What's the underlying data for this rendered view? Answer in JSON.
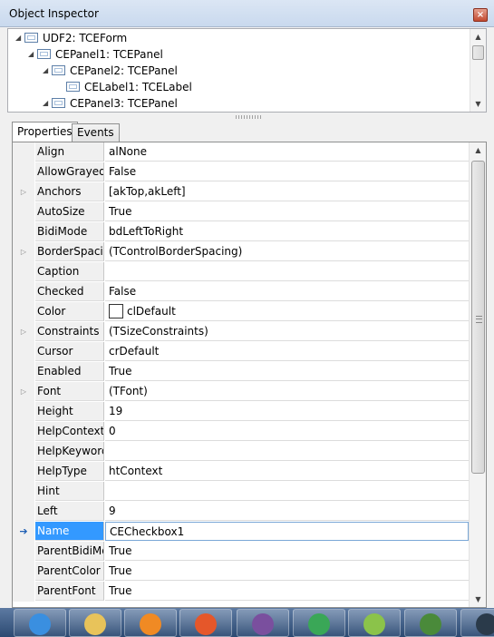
{
  "window": {
    "title": "Object Inspector",
    "close_glyph": "×"
  },
  "tree": {
    "nodes": [
      {
        "label": "UDF2: TCEForm",
        "expander": "◢"
      },
      {
        "label": "CEPanel1: TCEPanel",
        "expander": "◢"
      },
      {
        "label": "CEPanel2: TCEPanel",
        "expander": "◢"
      },
      {
        "label": "CELabel1: TCELabel",
        "expander": ""
      },
      {
        "label": "CEPanel3: TCEPanel",
        "expander": "◢"
      }
    ]
  },
  "tabs": [
    {
      "label": "Properties",
      "active": true
    },
    {
      "label": "Events",
      "active": false
    }
  ],
  "properties": [
    {
      "name": "Align",
      "value": "alNone",
      "expandable": false
    },
    {
      "name": "AllowGrayed",
      "value": "False",
      "expandable": false
    },
    {
      "name": "Anchors",
      "value": "[akTop,akLeft]",
      "expandable": true
    },
    {
      "name": "AutoSize",
      "value": "True",
      "expandable": false
    },
    {
      "name": "BidiMode",
      "value": "bdLeftToRight",
      "expandable": false
    },
    {
      "name": "BorderSpacing",
      "value": "(TControlBorderSpacing)",
      "expandable": true
    },
    {
      "name": "Caption",
      "value": "",
      "expandable": false
    },
    {
      "name": "Checked",
      "value": "False",
      "expandable": false
    },
    {
      "name": "Color",
      "value": "clDefault",
      "expandable": false,
      "swatch": "#ffffff"
    },
    {
      "name": "Constraints",
      "value": "(TSizeConstraints)",
      "expandable": true
    },
    {
      "name": "Cursor",
      "value": "crDefault",
      "expandable": false
    },
    {
      "name": "Enabled",
      "value": "True",
      "expandable": false
    },
    {
      "name": "Font",
      "value": "(TFont)",
      "expandable": true
    },
    {
      "name": "Height",
      "value": "19",
      "expandable": false
    },
    {
      "name": "HelpContext",
      "value": "0",
      "expandable": false
    },
    {
      "name": "HelpKeyword",
      "value": "",
      "expandable": false
    },
    {
      "name": "HelpType",
      "value": "htContext",
      "expandable": false
    },
    {
      "name": "Hint",
      "value": "",
      "expandable": false
    },
    {
      "name": "Left",
      "value": "9",
      "expandable": false
    },
    {
      "name": "Name",
      "value": "CECheckbox1",
      "expandable": false,
      "selected": true
    },
    {
      "name": "ParentBidiMode",
      "value": "True",
      "expandable": false
    },
    {
      "name": "ParentColor",
      "value": "True",
      "expandable": false
    },
    {
      "name": "ParentFont",
      "value": "True",
      "expandable": false
    }
  ],
  "glyphs": {
    "expand": "▷",
    "current": "➔",
    "up": "▲",
    "down": "▼"
  },
  "colors": {
    "selection": "#3399ff",
    "gutter": "#f0f0f0",
    "taskbar": "#2c4a72"
  },
  "taskbar": {
    "apps": [
      {
        "name": "internet-explorer-icon",
        "color": "#3a8fe0"
      },
      {
        "name": "file-explorer-icon",
        "color": "#e8c35a"
      },
      {
        "name": "media-player-icon",
        "color": "#f08a24"
      },
      {
        "name": "firefox-icon",
        "color": "#e5572a"
      },
      {
        "name": "tor-browser-icon",
        "color": "#7a4f9e"
      },
      {
        "name": "chrome-icon",
        "color": "#3aa757"
      },
      {
        "name": "notepad-plus-plus-icon",
        "color": "#8bc34a"
      },
      {
        "name": "system-monitor-icon",
        "color": "#4a8a3a"
      },
      {
        "name": "settings-gear-icon",
        "color": "#2a3a4a"
      }
    ]
  }
}
